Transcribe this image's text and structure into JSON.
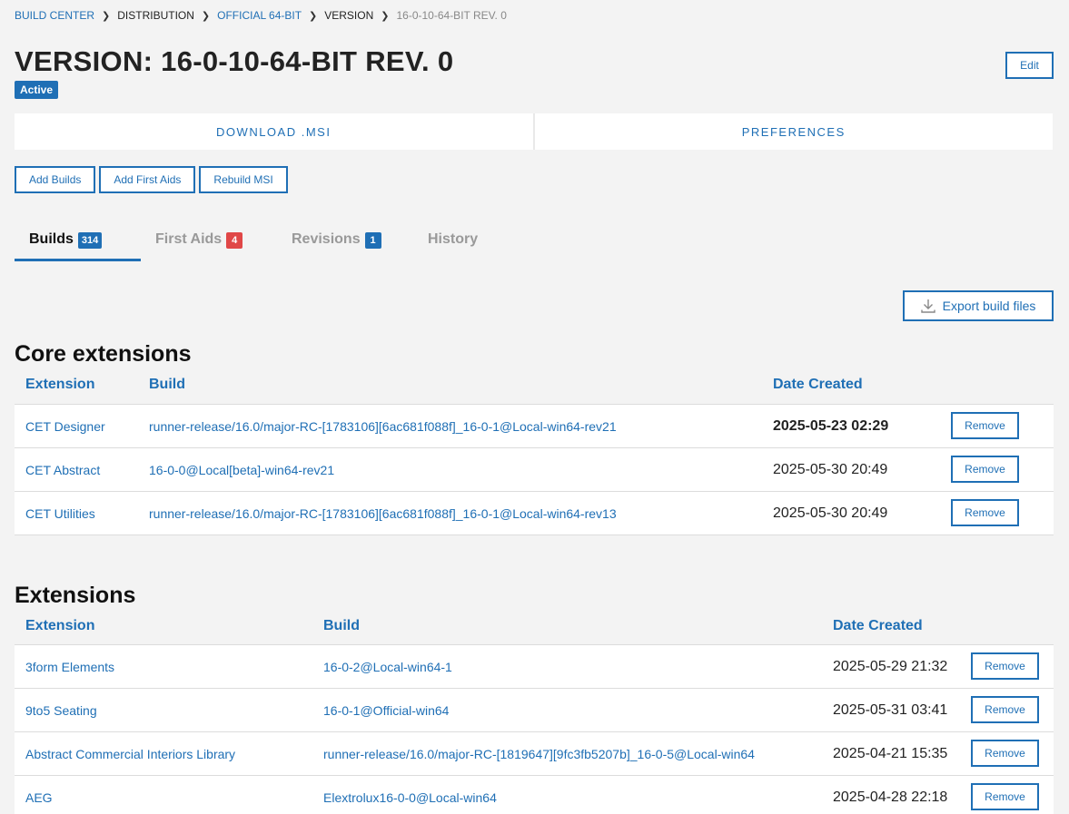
{
  "breadcrumb": [
    {
      "label": "BUILD CENTER",
      "style": "link"
    },
    {
      "label": "DISTRIBUTION",
      "style": "plain"
    },
    {
      "label": "OFFICIAL 64-BIT",
      "style": "link"
    },
    {
      "label": "VERSION",
      "style": "plain"
    },
    {
      "label": "16-0-10-64-BIT REV. 0",
      "style": "current"
    }
  ],
  "page": {
    "title": "VERSION: 16-0-10-64-BIT REV. 0",
    "status": "Active",
    "edit_label": "Edit"
  },
  "actions": {
    "download": "DOWNLOAD .MSI",
    "preferences": "PREFERENCES"
  },
  "buttons": {
    "add_builds": "Add Builds",
    "add_first_aids": "Add First Aids",
    "rebuild_msi": "Rebuild MSI"
  },
  "tabs": [
    {
      "label": "Builds",
      "count": "314",
      "count_color": "#1f6fb5",
      "active": true
    },
    {
      "label": "First Aids",
      "count": "4",
      "count_color": "#e04747",
      "active": false
    },
    {
      "label": "Revisions",
      "count": "1",
      "count_color": "#1f6fb5",
      "active": false
    },
    {
      "label": "History",
      "count": "",
      "active": false
    }
  ],
  "export_label": "Export build files",
  "core": {
    "title": "Core extensions",
    "columns": {
      "extension": "Extension",
      "build": "Build",
      "date": "Date Created"
    },
    "rows": [
      {
        "extension": "CET Designer",
        "build": "runner-release/16.0/major-RC-[1783106][6ac681f088f]_16-0-1@Local-win64-rev21",
        "date": "2025-05-23 02:29",
        "bold": true,
        "action": "Remove"
      },
      {
        "extension": "CET Abstract",
        "build": "16-0-0@Local[beta]-win64-rev21",
        "date": "2025-05-30 20:49",
        "bold": false,
        "action": "Remove"
      },
      {
        "extension": "CET Utilities",
        "build": "runner-release/16.0/major-RC-[1783106][6ac681f088f]_16-0-1@Local-win64-rev13",
        "date": "2025-05-30 20:49",
        "bold": false,
        "action": "Remove"
      }
    ]
  },
  "extensions": {
    "title": "Extensions",
    "columns": {
      "extension": "Extension",
      "build": "Build",
      "date": "Date Created"
    },
    "rows": [
      {
        "extension": "3form Elements",
        "build": "16-0-2@Local-win64-1",
        "date": "2025-05-29 21:32",
        "action": "Remove"
      },
      {
        "extension": "9to5 Seating",
        "build": "16-0-1@Official-win64",
        "date": "2025-05-31 03:41",
        "action": "Remove"
      },
      {
        "extension": "Abstract Commercial Interiors Library",
        "build": "runner-release/16.0/major-RC-[1819647][9fc3fb5207b]_16-0-5@Local-win64",
        "date": "2025-04-21 15:35",
        "action": "Remove"
      },
      {
        "extension": "AEG",
        "build": "Elextrolux16-0-0@Local-win64",
        "date": "2025-04-28 22:18",
        "action": "Remove"
      }
    ]
  }
}
